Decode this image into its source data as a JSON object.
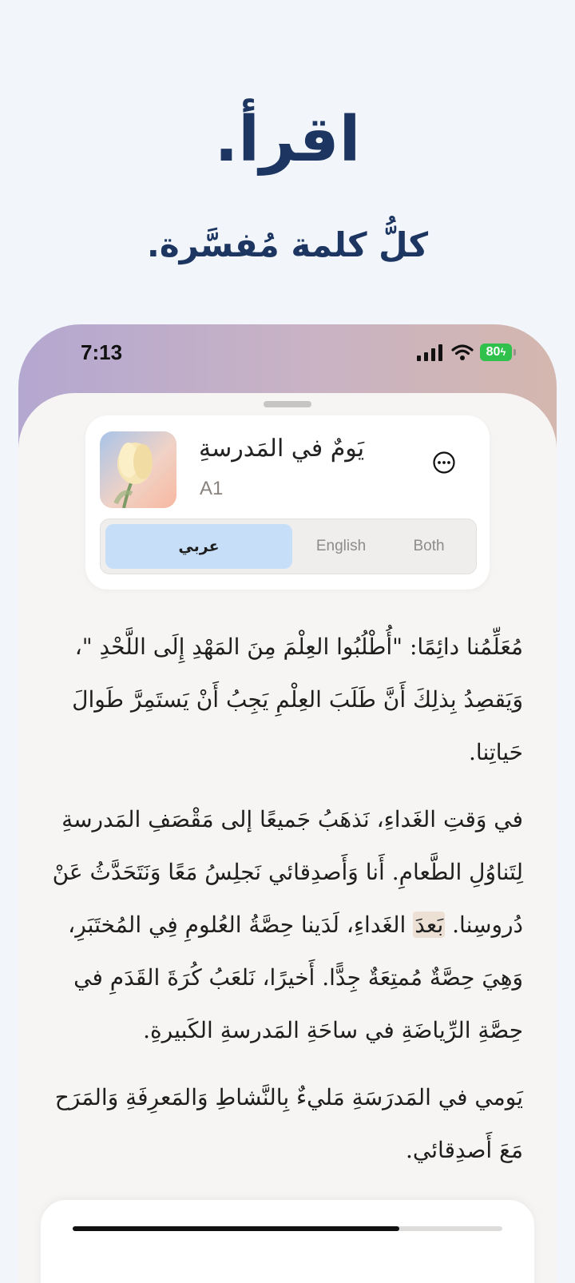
{
  "hero": {
    "title": "اقرأ.",
    "subtitle": "كلُّ كلمة مُفسَّرة."
  },
  "status_bar": {
    "time": "7:13",
    "battery": "80"
  },
  "card": {
    "story_title": "يَومٌ في المَدرسةِ",
    "level": "A1",
    "cover_icon": "tulip-image",
    "more_icon": "ellipsis-circle-icon"
  },
  "language_toggle": {
    "options": [
      "عربي",
      "English",
      "Both"
    ],
    "selected": "عربي"
  },
  "reading": {
    "p1": "مُعَلِّمُنا دائِمًا: \"أُطْلُبُوا العِلْمَ مِنَ المَهْدِ إِلَى اللَّحْدِ \"، وَيَقصِدُ بِذلِكَ أَنَّ طَلَبَ العِلْمِ يَجِبُ أَنْ يَستَمِرَّ طَوالَ حَياتِنا.",
    "p2_before": "في وَقتِ الغَداءِ، نَذهَبُ جَميعًا إلى مَقْصَفِ المَدرسةِ لِتَناوُلِ الطَّعامِ. أَنا وَأَصدِقائي نَجلِسُ مَعًا وَنَتَحَدَّثُ عَنْ دُروسِنا. ",
    "p2_highlight": "بَعدَ",
    "p2_after": " الغَداءِ، لَدَينا حِصَّةُ العُلومِ فِي المُختَبَرِ، وَهِيَ حِصَّةٌ مُمتِعَةٌ جِدًّا. أَخيرًا، نَلعَبُ كُرَةَ القَدَمِ في حِصَّةِ الرِّياضَةِ في ساحَةِ المَدرسةِ الكَبيرةِ.",
    "p3": "يَومي في المَدرَسَةِ مَليءٌ بِالنَّشاطِ وَالمَعرِفَةِ وَالمَرَح مَعَ أَصدِقائي."
  },
  "player": {
    "progress_fraction": 0.76
  }
}
